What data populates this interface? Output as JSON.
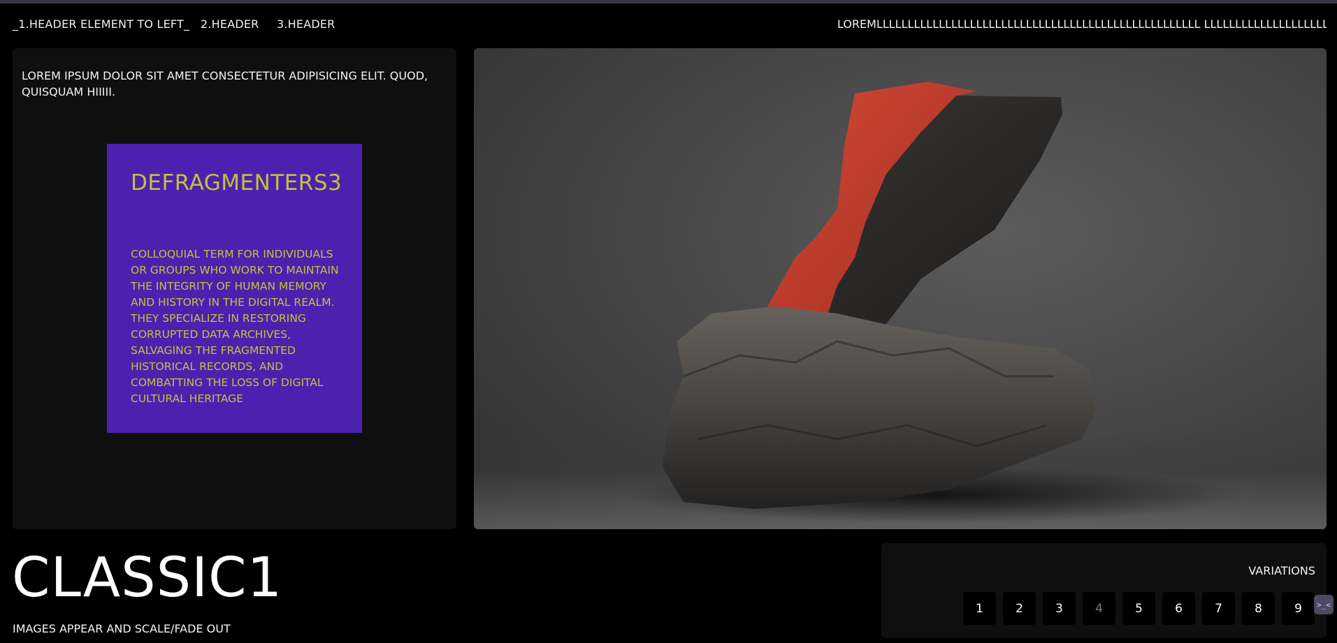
{
  "header": {
    "nav": [
      {
        "label": "_1.HEADER ELEMENT TO LEFT_"
      },
      {
        "label": "2.HEADER"
      },
      {
        "label": "3.HEADER"
      }
    ],
    "right_text": "LOREMLLLLLLLLLLLLLLLLLLLLLLLLLLLLLLLLLLLLLLLLLLLLLLLLLLLL LLLLLLLLLLLLLLLLLLLLLL"
  },
  "left_panel": {
    "intro": "LOREM IPSUM DOLOR SIT AMET CONSECTETUR ADIPISICING ELIT. QUOD, QUISQUAM HIIIII.",
    "card": {
      "title": "DEFRAGMENTERS3",
      "body": "COLLOQUIAL TERM FOR INDIVIDUALS OR GROUPS WHO WORK TO MAINTAIN THE INTEGRITY OF HUMAN MEMORY AND HISTORY IN THE DIGITAL REALM. THEY SPECIALIZE IN RESTORING CORRUPTED DATA ARCHIVES, SALVAGING THE FRAGMENTED HISTORICAL RECORDS, AND COMBATTING THE LOSS OF DIGITAL CULTURAL HERITAGE",
      "background_color": "#4b22b0",
      "text_color": "#c3c23d"
    }
  },
  "footer": {
    "big_title": "CLASSIC1",
    "subtitle": "IMAGES APPEAR AND SCALE/FADE OUT"
  },
  "variations": {
    "label": "VARIATIONS",
    "buttons": [
      "1",
      "2",
      "3",
      "4",
      "5",
      "6",
      "7",
      "8",
      "9"
    ],
    "selected": "4"
  },
  "corner_widget": {
    "icon": "code-collapse-icon",
    "glyph": ">_<"
  }
}
